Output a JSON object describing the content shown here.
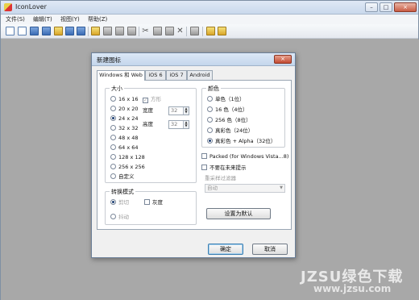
{
  "app": {
    "title": "IconLover",
    "window_controls": {
      "minimize": "–",
      "maximize": "□",
      "close": "×"
    }
  },
  "menubar": {
    "items": [
      "文件(S)",
      "编辑(T)",
      "视图(Y)",
      "帮助(Z)"
    ]
  },
  "toolbar": {
    "icons": [
      "new-file-icon",
      "new-image-icon",
      "open-icon",
      "save-icon",
      "export-icon",
      "import-icon",
      "grid-icon",
      "folder-icon",
      "film-icon",
      "print-icon",
      "cut-icon",
      "copy-icon",
      "paste-icon",
      "delete-icon",
      "properties-icon",
      "library-icon",
      "help-icon"
    ]
  },
  "dialog": {
    "title": "新建图标",
    "close": "×",
    "tabs": [
      "Windows 和 Web",
      "iOS 6",
      "iOS 7",
      "Android"
    ],
    "size_group": {
      "label": "大小",
      "options": [
        "16 x 16",
        "20 x 20",
        "24 x 24",
        "32 x 32",
        "48 x 48",
        "64 x 64",
        "128 x 128",
        "256 x 256",
        "自定义"
      ],
      "selected": "24 x 24",
      "square_label": "方形",
      "width_label": "宽度",
      "width_value": "32",
      "height_label": "高度",
      "height_value": "32"
    },
    "color_group": {
      "label": "颜色",
      "options": [
        "单色（1位）",
        "16 色（4位）",
        "256 色（8位）",
        "真彩色（24位）",
        "真彩色 + Alpha（32位）"
      ],
      "selected": "真彩色 + Alpha（32位）"
    },
    "packed_label": "Packed (for Windows Vista...8)",
    "no_prompt_label": "不要在未来提示",
    "resample_label": "重采样过滤器",
    "resample_value": "自动",
    "convert_group": {
      "label": "转换模式",
      "crop_label": "剪切",
      "gray_label": "灰度",
      "dither_label": "抖动"
    },
    "set_default_button": "设置为默认",
    "ok_button": "确定",
    "cancel_button": "取消"
  },
  "watermark": {
    "text": "JZSU绿色下载",
    "url": "www.jzsu.com"
  }
}
